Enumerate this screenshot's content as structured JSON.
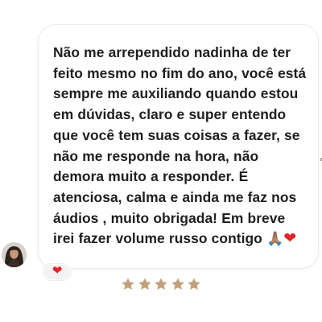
{
  "message": {
    "text": "Não me arrependido nadinha de ter feito mesmo no fim do ano, você está sempre me auxiliando quando estou em dúvidas, claro e super entendo que você tem suas coisas a fazer, se não me responde na hora, não demora muito a responder. É atenciosa, calma e ainda me faz nos áudios , muito obrigada! Em breve irei fazer volume russo contigo",
    "trailing_emojis": [
      {
        "icon": "folded-hands-icon",
        "glyph": "🙏🏽"
      },
      {
        "icon": "red-heart-icon",
        "glyph": "❤"
      }
    ]
  },
  "reaction": {
    "icon": "red-heart-icon",
    "glyph": "❤"
  },
  "rating": {
    "value": 5,
    "max": 5,
    "icon": "star-icon",
    "color": "#c2a07a"
  },
  "colors": {
    "text": "#1e1e1e",
    "bubble_border": "#ececec",
    "heart": "#e0242c"
  }
}
